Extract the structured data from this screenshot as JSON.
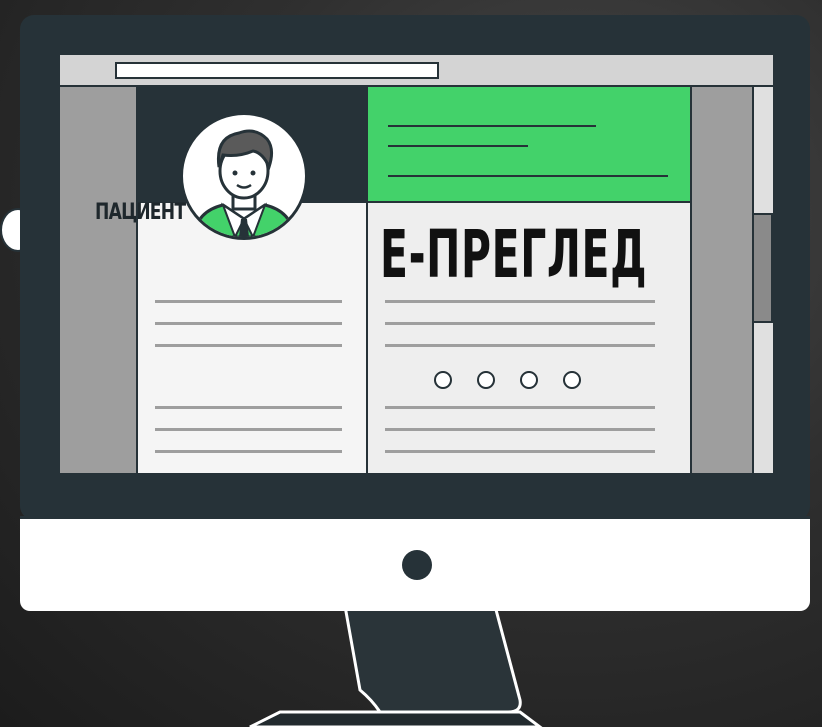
{
  "patient_panel": {
    "label": "ПАЦИЕНТ"
  },
  "exam_panel": {
    "title": "Е-ПРЕГЛЕД",
    "dot_count": 4
  },
  "colors": {
    "accent_green": "#43d26a",
    "dark_navy": "#263238",
    "panel_gray": "#9e9e9e"
  },
  "icons": {
    "avatar": "doctor-avatar-icon",
    "power": "power-button-icon",
    "camera": "side-camera-icon"
  }
}
